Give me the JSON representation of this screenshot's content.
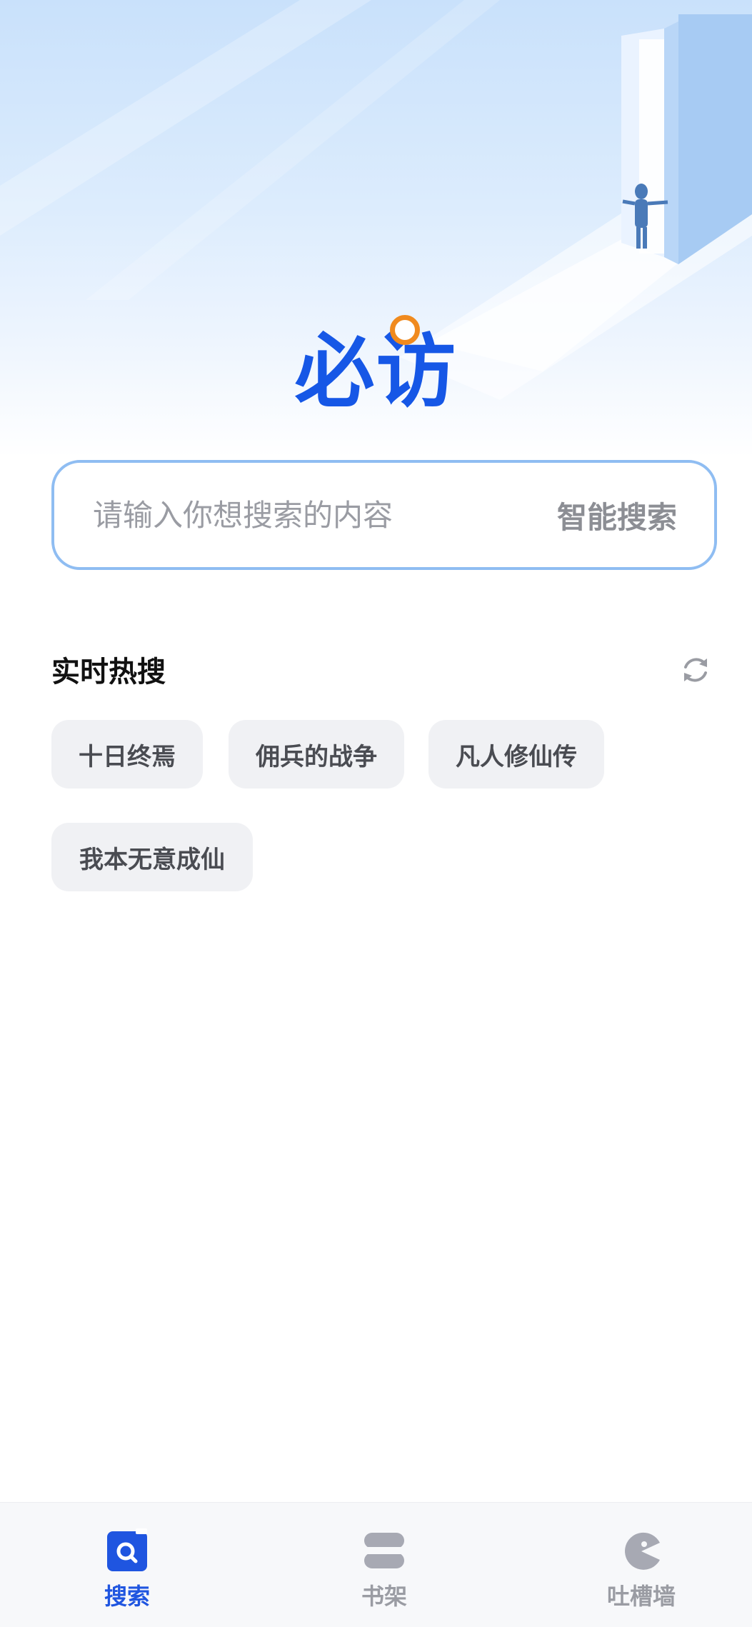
{
  "app": {
    "logo_text": "必访"
  },
  "search": {
    "placeholder": "请输入你想搜索的内容",
    "button_label": "智能搜索"
  },
  "hot_search": {
    "title": "实时热搜",
    "tags": [
      "十日终焉",
      "佣兵的战争",
      "凡人修仙传",
      "我本无意成仙"
    ]
  },
  "tabbar": {
    "items": [
      {
        "label": "搜索",
        "icon": "search-tab-icon",
        "active": true
      },
      {
        "label": "书架",
        "icon": "bookshelf-icon",
        "active": false
      },
      {
        "label": "吐槽墙",
        "icon": "pacman-icon",
        "active": false
      }
    ]
  },
  "colors": {
    "brand_blue": "#1657e6",
    "accent_orange": "#f08a1e",
    "search_border": "#8fbdf2",
    "tab_active": "#1f55e0",
    "tab_inactive": "#9a9ca3"
  }
}
